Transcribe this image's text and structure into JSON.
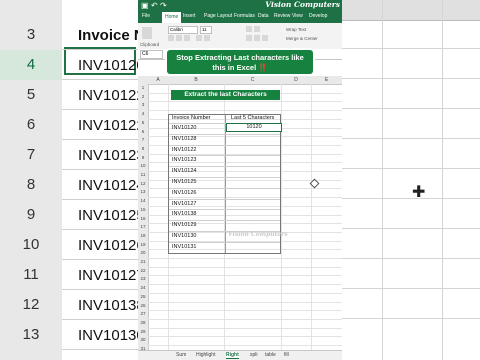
{
  "background_left": {
    "row_numbers": [
      "3",
      "4",
      "5",
      "6",
      "7",
      "8",
      "9",
      "10",
      "11",
      "12",
      "13"
    ],
    "header_text": "Invoice Nu",
    "cells": [
      "INV10120",
      "INV10122",
      "INV10122",
      "INV10123",
      "INV10124",
      "INV10125",
      "INV10126",
      "INV10127",
      "INV10138",
      "INV10130",
      "INV10131"
    ]
  },
  "titlebar": {
    "brand": "Vision Computers"
  },
  "ribbon": {
    "tabs": [
      "File",
      "Home",
      "Insert",
      "Page Layout",
      "Formulas",
      "Data",
      "Review",
      "View",
      "Develop"
    ],
    "active_tab": "Home",
    "font_name": "Calibri",
    "font_size": "11",
    "wrap_text": "Wrap Text",
    "merge_center": "Merge & Center",
    "clipboard_label": "Clipboard"
  },
  "formula_bar": {
    "name_box": "C6"
  },
  "callout": {
    "line1": "Stop Extracting Last characters like",
    "line2": "this in Excel",
    "emoji": "‼️"
  },
  "columns": [
    "A",
    "B",
    "C",
    "D",
    "E"
  ],
  "rows": [
    "1",
    "2",
    "3",
    "4",
    "5",
    "6",
    "7",
    "8",
    "9",
    "10",
    "11",
    "12",
    "13",
    "14",
    "15",
    "16",
    "17",
    "18",
    "19",
    "20",
    "21",
    "22",
    "23",
    "24",
    "25",
    "26",
    "27",
    "28",
    "29",
    "30",
    "31"
  ],
  "banner": "Extract the last Characters",
  "table": {
    "headers": [
      "Invoice Number",
      "Last 5 Characters"
    ],
    "invoices": [
      "INV10120",
      "INV10128",
      "INV10122",
      "INV10123",
      "INV10124",
      "INV10125",
      "INV10126",
      "INV10127",
      "INV10138",
      "INV10129",
      "INV10130",
      "INV10131"
    ],
    "result_first": "10120"
  },
  "watermark": "Vision Computers",
  "sheet_tabs": [
    "Sum",
    "Highlight",
    "Right",
    "spli",
    "table",
    "fill"
  ],
  "active_sheet": "Right"
}
